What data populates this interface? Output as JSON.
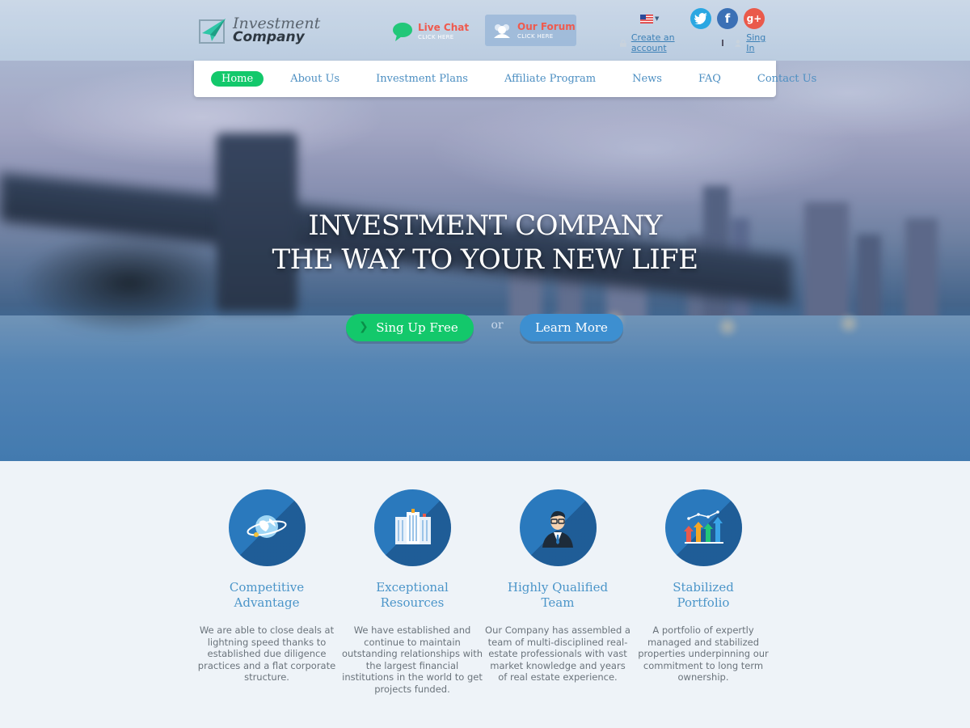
{
  "header": {
    "logo_line1": "Investment",
    "logo_line2": "Company",
    "live_chat": {
      "title": "Live Chat",
      "subtitle": "CLICK HERE",
      "icon": "chat-bubble-icon"
    },
    "forum": {
      "title": "Our Forum",
      "subtitle": "CLICK HERE",
      "icon": "forum-people-icon"
    },
    "language": {
      "icon": "us-flag-icon"
    },
    "social": [
      {
        "name": "twitter",
        "icon": "twitter-icon",
        "color": "#2aa7e2"
      },
      {
        "name": "facebook",
        "icon": "facebook-icon",
        "color": "#3b70b5"
      },
      {
        "name": "google-plus",
        "icon": "google-plus-icon",
        "color": "#ea5a4b"
      }
    ],
    "create_account": "Create an account",
    "sign_in": "Sing In"
  },
  "nav": {
    "items": [
      "Home",
      "About Us",
      "Investment Plans",
      "Affiliate Program",
      "News",
      "FAQ",
      "Contact Us"
    ],
    "active": "Home"
  },
  "hero": {
    "title_line1": "INVESTMENT COMPANY",
    "title_line2": "THE WAY TO YOUR NEW LIFE",
    "signup_label": "Sing Up Free",
    "or_label": "or",
    "learn_label": "Learn More"
  },
  "features": [
    {
      "icon": "globe-icon",
      "title_line1": "Competitive",
      "title_line2": "Advantage",
      "text": "We are able to close deals at lightning speed thanks to established due diligence practices and a flat corporate structure."
    },
    {
      "icon": "buildings-icon",
      "title_line1": "Exceptional",
      "title_line2": "Resources",
      "text": "We have established and continue to maintain outstanding relationships with the largest financial institutions in the world to get projects funded."
    },
    {
      "icon": "businessman-icon",
      "title_line1": "Highly Qualified",
      "title_line2": "Team",
      "text": "Our Company has assembled a team of multi-disciplined real-estate professionals with vast market knowledge and years of real estate experience."
    },
    {
      "icon": "growth-chart-icon",
      "title_line1": "Stabilized",
      "title_line2": "Portfolio",
      "text": "A portfolio of expertly managed and stabilized properties underpinning our commitment to long term ownership."
    }
  ],
  "colors": {
    "accent_green": "#13c86b",
    "accent_blue": "#3d8fd0",
    "link_blue": "#4d8fc2",
    "alert_red": "#ef5a4e"
  }
}
